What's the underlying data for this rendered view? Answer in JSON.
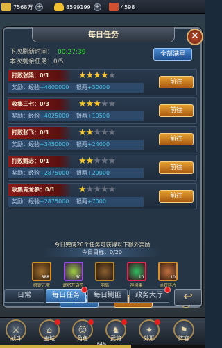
{
  "resources": [
    {
      "value": "7568万",
      "icon": "coin-icon",
      "color": "#e0b640"
    },
    {
      "value": "8599199",
      "icon": "gold-ingot-icon",
      "color": "#f0c030"
    },
    {
      "value": "4598",
      "icon": "vip-icon",
      "color": "#d05030"
    }
  ],
  "dialog": {
    "title": "每日任务",
    "refresh_label": "下次刷新时间：",
    "refresh_time": "00:27:39",
    "remaining_label": "本次剩余任务：0/5",
    "complete_all_label": "全部满星"
  },
  "tasks": [
    {
      "name": "打败张梁：0/1",
      "stars": 4,
      "reward_prefix": "奖励：经验",
      "exp": "+4600000",
      "silver_prefix": "银两",
      "silver": "+30000",
      "button": "前往"
    },
    {
      "name": "收集三七：0/3",
      "stars": 3,
      "reward_prefix": "奖励：经验",
      "exp": "+4025000",
      "silver_prefix": "银两",
      "silver": "+10500",
      "button": "前往"
    },
    {
      "name": "打败张飞：0/1",
      "stars": 2,
      "reward_prefix": "奖励：经验",
      "exp": "+3450000",
      "silver_prefix": "银两",
      "silver": "+24000",
      "button": "前往"
    },
    {
      "name": "打败甄宓：0/1",
      "stars": 2,
      "reward_prefix": "奖励：经验",
      "exp": "+2875000",
      "silver_prefix": "银两",
      "silver": "+20000",
      "button": "前往"
    },
    {
      "name": "收集青龙参：0/1",
      "stars": 1,
      "reward_prefix": "奖励：经验",
      "exp": "+2875000",
      "silver_prefix": "银两",
      "silver": "+7000",
      "button": "前往"
    }
  ],
  "bonus": {
    "title": "今日完成20个任务可获得以下额外奖励",
    "goal": "今日目标：0/20",
    "items": [
      {
        "label": "绑定元宝",
        "count": "888",
        "color": "#d6902a",
        "icon": "ingot-chest-icon"
      },
      {
        "label": "武将开启符",
        "count": "50",
        "color": "#8a3ad0",
        "icon": "talisman-icon"
      },
      {
        "label": "羽扇",
        "count": "",
        "color": "#b8862a",
        "icon": "fan-icon"
      },
      {
        "label": "神树果",
        "count": "10",
        "color": "#d02040",
        "icon": "fruit-icon"
      },
      {
        "label": "孟获碎片",
        "count": "10",
        "color": "#c88830",
        "icon": "hero-fragment-icon"
      }
    ],
    "one_click": "一键完成",
    "claim": "领取",
    "warn": "!"
  },
  "tabs": [
    {
      "label": "日常",
      "active": false,
      "dot": false
    },
    {
      "label": "每日任务",
      "active": true,
      "dot": true
    },
    {
      "label": "每日剿匪",
      "active": false,
      "dot": false
    },
    {
      "label": "政务大厅",
      "active": false,
      "dot": true
    }
  ],
  "back_icon": "back-arrow-icon",
  "nav": [
    {
      "label": "战斗",
      "dot": false
    },
    {
      "label": "主城",
      "dot": true
    },
    {
      "label": "角色",
      "dot": true
    },
    {
      "label": "武将",
      "dot": true
    },
    {
      "label": "外形",
      "dot": true
    },
    {
      "label": "阵容",
      "dot": false
    }
  ],
  "xp": {
    "percent": 64,
    "label": "64%"
  }
}
